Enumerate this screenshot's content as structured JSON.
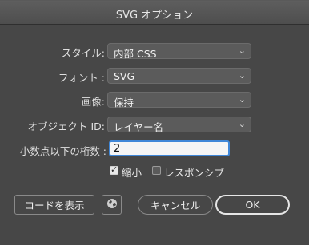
{
  "dialog": {
    "title": "SVG オプション"
  },
  "fields": {
    "style": {
      "label": "スタイル:",
      "value": "内部 CSS"
    },
    "font": {
      "label": "フォント :",
      "value": "SVG"
    },
    "image": {
      "label": "画像:",
      "value": "保持"
    },
    "object_id": {
      "label": "オブジェクト ID:",
      "value": "レイヤー名"
    },
    "decimal": {
      "label": "小数点以下の桁数 :",
      "value": "2"
    }
  },
  "checkboxes": {
    "minify": {
      "label": "縮小",
      "checked": true
    },
    "responsive": {
      "label": "レスポンシブ",
      "checked": false
    }
  },
  "buttons": {
    "show_code": "コードを表示",
    "cancel": "キャンセル",
    "ok": "OK"
  },
  "icons": {
    "web": "globe-icon",
    "dropdown": "chevron-updown-icon"
  },
  "colors": {
    "dialog_bg": "#474747",
    "field_focus": "#3f87d8"
  }
}
